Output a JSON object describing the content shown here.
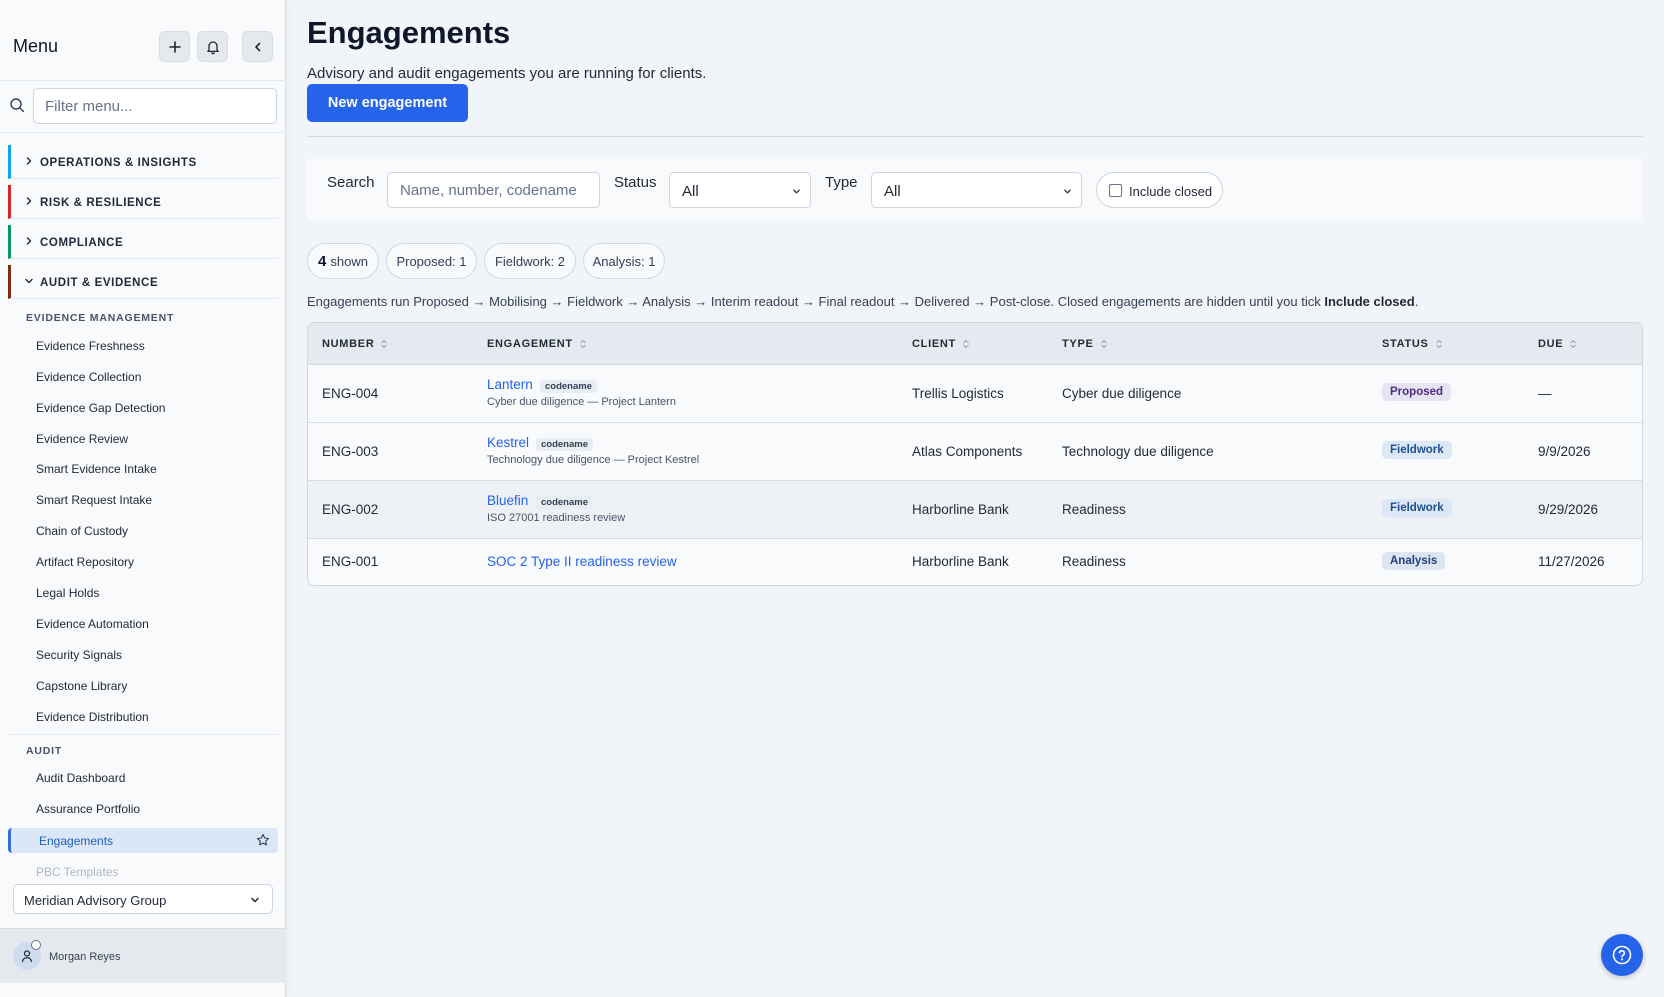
{
  "sidebar": {
    "title": "Menu",
    "filter_placeholder": "Filter menu...",
    "sections": [
      {
        "label": "OPERATIONS & INSIGHTS",
        "accent": "#0ea5e9",
        "expanded": false
      },
      {
        "label": "RISK & RESILIENCE",
        "accent": "#dc2626",
        "expanded": false
      },
      {
        "label": "COMPLIANCE",
        "accent": "#059669",
        "expanded": false
      },
      {
        "label": "AUDIT & EVIDENCE",
        "accent": "#7c2d12",
        "expanded": true
      }
    ],
    "groups": [
      {
        "label": "EVIDENCE MANAGEMENT",
        "items": [
          "Evidence Freshness",
          "Evidence Collection",
          "Evidence Gap Detection",
          "Evidence Review",
          "Smart Evidence Intake",
          "Smart Request Intake",
          "Chain of Custody",
          "Artifact Repository",
          "Legal Holds",
          "Evidence Automation",
          "Security Signals",
          "Capstone Library",
          "Evidence Distribution"
        ]
      },
      {
        "label": "AUDIT",
        "items": [
          "Audit Dashboard",
          "Assurance Portfolio"
        ]
      }
    ],
    "active_item": "Engagements",
    "faded_item": "PBC Templates",
    "org": "Meridian Advisory Group",
    "user": "Morgan Reyes"
  },
  "main": {
    "title": "Engagements",
    "subtitle": "Advisory and audit engagements you are running for clients.",
    "new_button": "New engagement",
    "filters": {
      "search_label": "Search",
      "search_placeholder": "Name, number, codename",
      "status_label": "Status",
      "status_value": "All",
      "type_label": "Type",
      "type_value": "All",
      "include_closed_label": "Include closed",
      "include_closed_checked": false
    },
    "summary": {
      "shown_count": "4",
      "shown_label": "shown",
      "pills": [
        "Proposed: 1",
        "Fieldwork: 2",
        "Analysis: 1"
      ]
    },
    "note_text": "Engagements run Proposed → Mobilising → Fieldwork → Analysis → Interim readout → Final readout → Delivered → Post-close. Closed engagements are hidden until you tick ",
    "note_bold": "Include closed",
    "note_end": ".",
    "table": {
      "columns": [
        "NUMBER",
        "ENGAGEMENT",
        "CLIENT",
        "TYPE",
        "STATUS",
        "DUE"
      ],
      "codename_label": "codename",
      "rows": [
        {
          "number": "ENG-004",
          "name": "Lantern",
          "has_codename": true,
          "sub": "Cyber due diligence — Project Lantern",
          "client": "Trellis Logistics",
          "type": "Cyber due diligence",
          "status": "Proposed",
          "due": "—"
        },
        {
          "number": "ENG-003",
          "name": "Kestrel",
          "has_codename": true,
          "sub": "Technology due diligence — Project Kestrel",
          "client": "Atlas Components",
          "type": "Technology due diligence",
          "status": "Fieldwork",
          "due": "9/9/2026"
        },
        {
          "number": "ENG-002",
          "name": "Bluefin",
          "has_codename": true,
          "sub": "ISO 27001 readiness review",
          "client": "Harborline Bank",
          "type": "Readiness",
          "status": "Fieldwork",
          "due": "9/29/2026"
        },
        {
          "number": "ENG-001",
          "name": "SOC 2 Type II readiness review",
          "has_codename": false,
          "sub": "",
          "client": "Harborline Bank",
          "type": "Readiness",
          "status": "Analysis",
          "due": "11/27/2026"
        }
      ]
    }
  },
  "colors": {
    "primary": "#2563eb",
    "active_nav_bg": "#dbe7f6"
  }
}
